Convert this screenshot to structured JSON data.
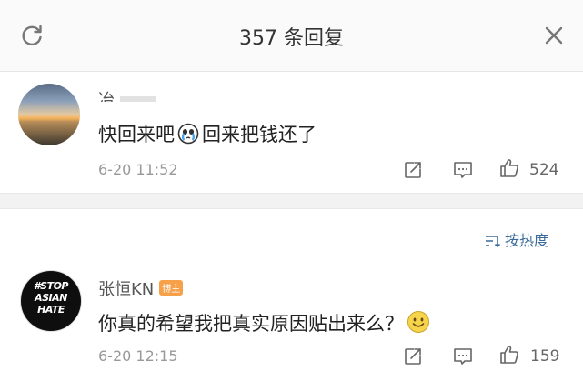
{
  "header": {
    "title": "357 条回复"
  },
  "sort": {
    "label": "按热度"
  },
  "comments": [
    {
      "username": "冶",
      "text_before": "快回来吧",
      "text_after": "回来把钱还了",
      "time": "6-20 11:52",
      "likes": "524"
    },
    {
      "username": "张恒KN",
      "badge": "博主",
      "text": "你真的希望我把真实原因贴出来么？",
      "time": "6-20 12:15",
      "likes": "159",
      "avatar_text": "#STOP ASIAN HATE"
    }
  ],
  "colors": {
    "accent": "#3a6a99",
    "badge": "#f6a04a"
  }
}
